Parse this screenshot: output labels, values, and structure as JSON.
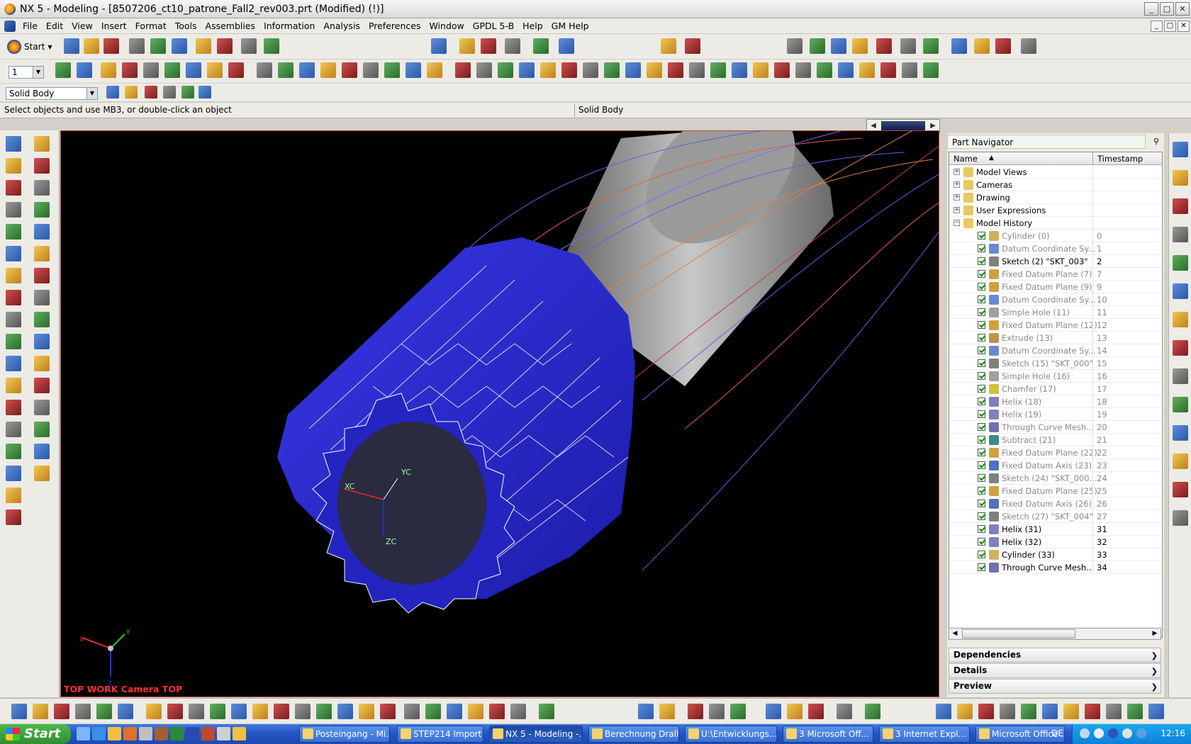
{
  "window": {
    "title": "NX 5 - Modeling - [8507206_ct10_patrone_Fall2_rev003.prt (Modified)    (!)]",
    "controls": [
      "_",
      "□",
      "✕"
    ]
  },
  "menubar": {
    "items": [
      "File",
      "Edit",
      "View",
      "Insert",
      "Format",
      "Tools",
      "Assemblies",
      "Information",
      "Analysis",
      "Preferences",
      "Window",
      "GPDL 5-B",
      "Help",
      "GM Help"
    ]
  },
  "toolbar": {
    "start_label": "Start",
    "layer_value": "1",
    "filter_value": "Solid Body"
  },
  "status": {
    "cue": "Select objects and use MB3, or double-click an object",
    "selection": "Solid Body"
  },
  "viewport": {
    "camera_label": "TOP WORK Camera TOP",
    "axis_labels": {
      "xc": "XC",
      "yc": "YC",
      "zc": "ZC",
      "x": "X",
      "y": "Y",
      "z": "Z"
    }
  },
  "part_navigator": {
    "title": "Part Navigator",
    "columns": {
      "name": "Name",
      "timestamp": "Timestamp"
    },
    "groups": [
      {
        "label": "Model Views",
        "expander": "+"
      },
      {
        "label": "Cameras",
        "expander": "+"
      },
      {
        "label": "Drawing",
        "expander": "+"
      },
      {
        "label": "User Expressions",
        "expander": "+"
      },
      {
        "label": "Model History",
        "expander": "−"
      }
    ],
    "features": [
      {
        "name": "Cylinder (0)",
        "ts": "0",
        "dim": true,
        "icon": "cylinder-icon"
      },
      {
        "name": "Datum Coordinate Sy...",
        "ts": "1",
        "dim": true,
        "icon": "datum-csys-icon"
      },
      {
        "name": "Sketch (2) \"SKT_003\"",
        "ts": "2",
        "dim": false,
        "icon": "sketch-icon"
      },
      {
        "name": "Fixed Datum Plane (7)",
        "ts": "7",
        "dim": true,
        "icon": "datum-plane-icon"
      },
      {
        "name": "Fixed Datum Plane (9)",
        "ts": "9",
        "dim": true,
        "icon": "datum-plane-icon"
      },
      {
        "name": "Datum Coordinate Sy...",
        "ts": "10",
        "dim": true,
        "icon": "datum-csys-icon"
      },
      {
        "name": "Simple Hole (11)",
        "ts": "11",
        "dim": true,
        "icon": "hole-icon"
      },
      {
        "name": "Fixed Datum Plane (12)",
        "ts": "12",
        "dim": true,
        "icon": "datum-plane-icon"
      },
      {
        "name": "Extrude (13)",
        "ts": "13",
        "dim": true,
        "icon": "extrude-icon"
      },
      {
        "name": "Datum Coordinate Sy...",
        "ts": "14",
        "dim": true,
        "icon": "datum-csys-icon"
      },
      {
        "name": "Sketch (15) \"SKT_000\"",
        "ts": "15",
        "dim": true,
        "icon": "sketch-icon"
      },
      {
        "name": "Simple Hole (16)",
        "ts": "16",
        "dim": true,
        "icon": "hole-icon"
      },
      {
        "name": "Chamfer (17)",
        "ts": "17",
        "dim": true,
        "icon": "chamfer-icon"
      },
      {
        "name": "Helix (18)",
        "ts": "18",
        "dim": true,
        "icon": "helix-icon"
      },
      {
        "name": "Helix (19)",
        "ts": "19",
        "dim": true,
        "icon": "helix-icon"
      },
      {
        "name": "Through Curve Mesh...",
        "ts": "20",
        "dim": true,
        "icon": "curve-mesh-icon"
      },
      {
        "name": "Subtract (21)",
        "ts": "21",
        "dim": true,
        "icon": "subtract-icon"
      },
      {
        "name": "Fixed Datum Plane (22)",
        "ts": "22",
        "dim": true,
        "icon": "datum-plane-icon"
      },
      {
        "name": "Fixed Datum Axis (23)",
        "ts": "23",
        "dim": true,
        "icon": "datum-axis-icon"
      },
      {
        "name": "Sketch (24) \"SKT_000...",
        "ts": "24",
        "dim": true,
        "icon": "sketch-icon"
      },
      {
        "name": "Fixed Datum Plane (25)",
        "ts": "25",
        "dim": true,
        "icon": "datum-plane-icon"
      },
      {
        "name": "Fixed Datum Axis (26)",
        "ts": "26",
        "dim": true,
        "icon": "datum-axis-icon"
      },
      {
        "name": "Sketch (27) \"SKT_004\"",
        "ts": "27",
        "dim": true,
        "icon": "sketch-icon"
      },
      {
        "name": "Helix (31)",
        "ts": "31",
        "dim": false,
        "icon": "helix-icon"
      },
      {
        "name": "Helix (32)",
        "ts": "32",
        "dim": false,
        "icon": "helix-icon"
      },
      {
        "name": "Cylinder (33)",
        "ts": "33",
        "dim": false,
        "icon": "cylinder-icon"
      },
      {
        "name": "Through Curve Mesh...",
        "ts": "34",
        "dim": false,
        "icon": "curve-mesh-icon"
      }
    ],
    "sections": [
      "Dependencies",
      "Details",
      "Preview"
    ]
  },
  "taskbar": {
    "start_label": "Start",
    "tasks": [
      {
        "label": "Posteingang - Mi...",
        "active": false
      },
      {
        "label": "STEP214 Import",
        "active": false
      },
      {
        "label": "NX 5 - Modeling -...",
        "active": true
      },
      {
        "label": "Berechnung Drall...",
        "active": false
      },
      {
        "label": "U:\\Entwicklungs...",
        "active": false
      },
      {
        "label": "3 Microsoft Off...",
        "active": false
      },
      {
        "label": "3 Internet Expl...",
        "active": false
      },
      {
        "label": "Microsoft Office ...",
        "active": false
      }
    ],
    "language": "DE",
    "clock": "12:16"
  },
  "colors": {
    "part_body": "#2b2bd6",
    "shaft": "#a8a8a8",
    "viewport_bg": "#000000",
    "camera_label": "#ff3030"
  }
}
